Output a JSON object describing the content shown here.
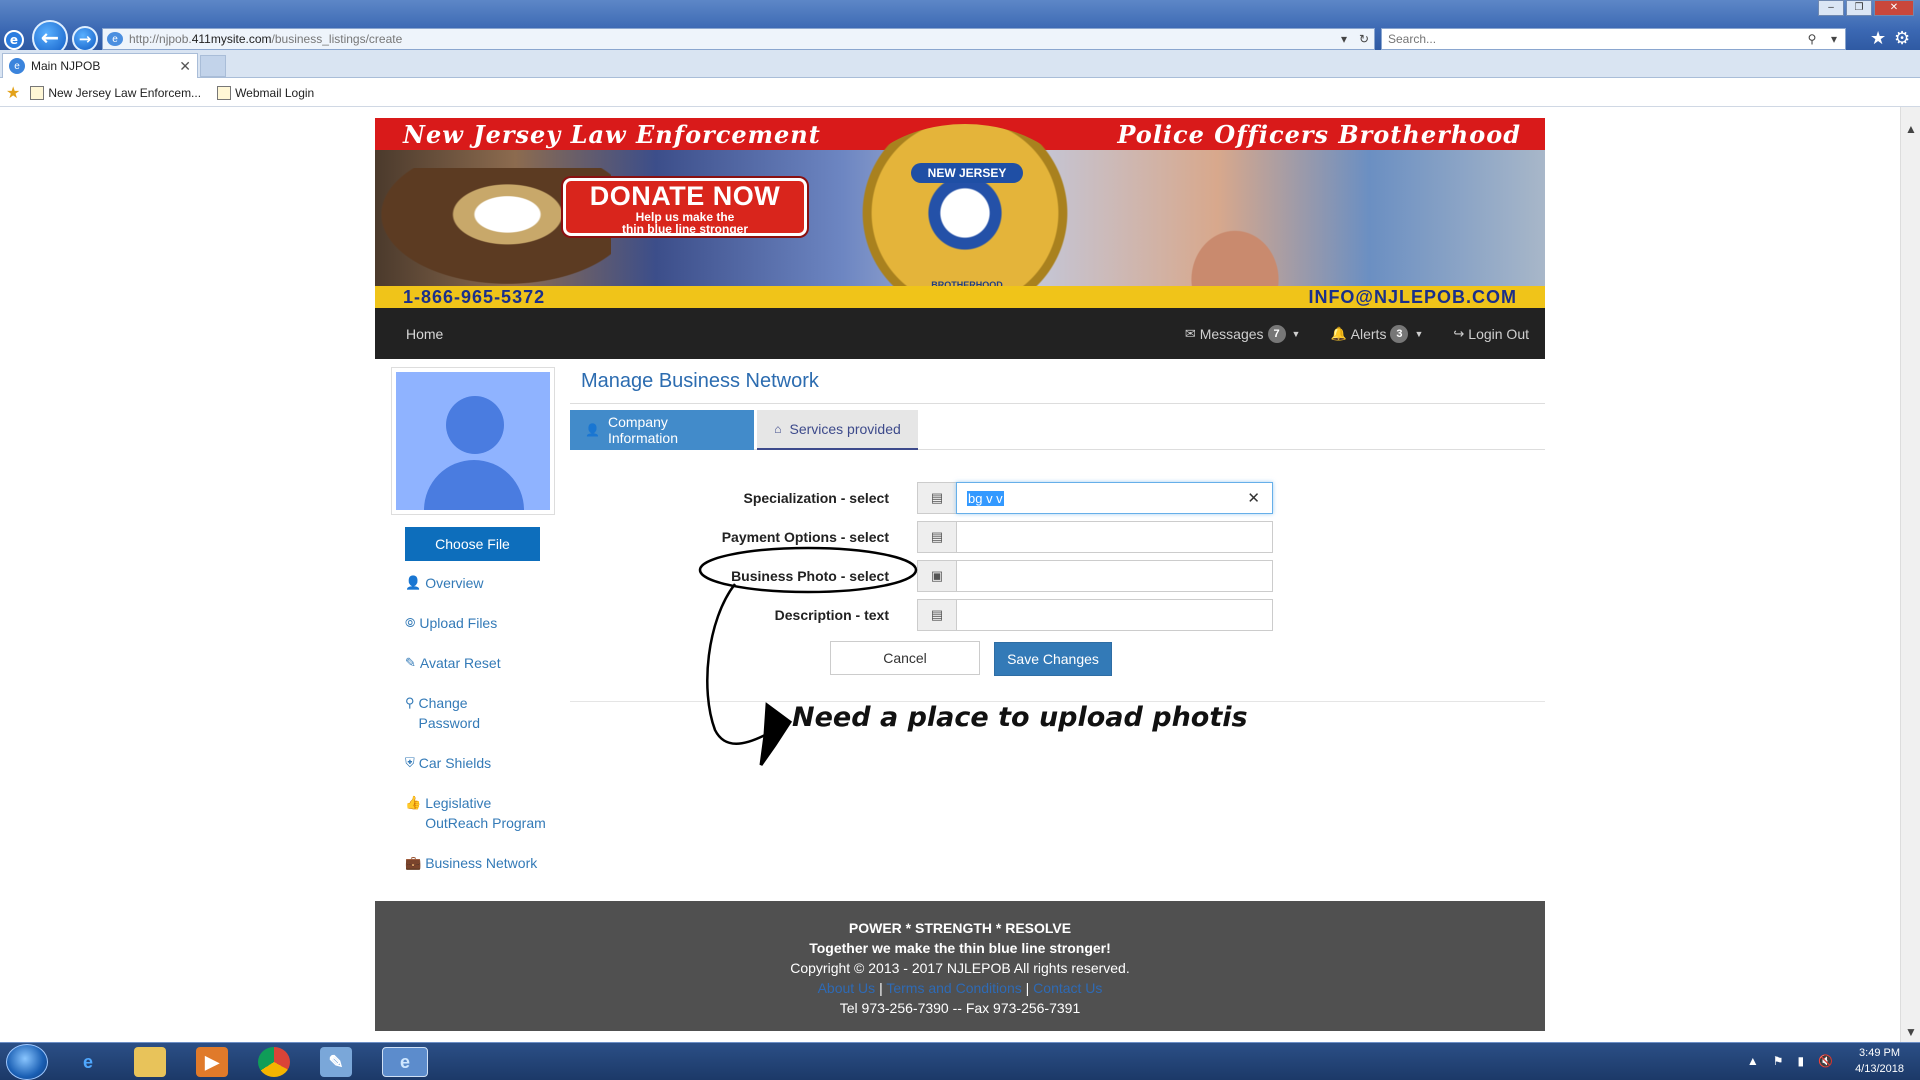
{
  "browser": {
    "url_prefix": "http://njpob.",
    "url_host": "411mysite.com",
    "url_path": "/business_listings/create",
    "search_placeholder": "Search...",
    "tab_title": "Main NJPOB",
    "favorites": [
      {
        "label": "New Jersey Law Enforcem..."
      },
      {
        "label": "Webmail Login"
      }
    ]
  },
  "banner": {
    "left_title": "New Jersey Law Enforcement",
    "right_title": "Police Officers Brotherhood",
    "donate_title": "DONATE NOW",
    "donate_sub1": "Help us make the",
    "donate_sub2": "thin blue line stronger",
    "badge_top": "NEW JERSEY",
    "badge_bottom": "BROTHERHOOD",
    "phone": "1-866-965-5372",
    "email": "INFO@NJLEPOB.COM"
  },
  "navbar": {
    "home": "Home",
    "messages_label": "Messages",
    "messages_count": "7",
    "alerts_label": "Alerts",
    "alerts_count": "3",
    "logout": "Login Out"
  },
  "sidebar": {
    "choose_file": "Choose File",
    "items": [
      {
        "label": "Overview",
        "icon": "user-icon"
      },
      {
        "label": "Upload Files",
        "icon": "upload-icon"
      },
      {
        "label": "Avatar Reset",
        "icon": "eraser-icon"
      },
      {
        "label": "Change Password",
        "icon": "key-icon"
      },
      {
        "label": "Car Shields",
        "icon": "shield-icon"
      },
      {
        "label": "Legislative OutReach Program",
        "icon": "thumbs-up-icon"
      },
      {
        "label": "Business Network",
        "icon": "briefcase-icon"
      }
    ]
  },
  "main": {
    "title": "Manage Business Network",
    "tabs": [
      {
        "label": "Company Information",
        "icon": "user-icon"
      },
      {
        "label": "Services provided",
        "icon": "home-icon"
      }
    ],
    "form": {
      "specialization_label": "Specialization - select",
      "specialization_value": "bg v  v",
      "payment_label": "Payment Options - select",
      "photo_label": "Business Photo - select",
      "description_label": "Description - text",
      "cancel": "Cancel",
      "save": "Save Changes"
    }
  },
  "annotation": {
    "text": "Need a place to upload photis"
  },
  "footer": {
    "line1": "POWER * STRENGTH * RESOLVE",
    "line2": "Together we make the thin blue line stronger!",
    "line3": "Copyright © 2013 - 2017 NJLEPOB   All rights reserved.",
    "link_about": "About Us",
    "link_terms": "Terms and Conditions",
    "link_contact": "Contact Us",
    "line5": "Tel 973-256-7390 -- Fax 973-256-7391"
  },
  "taskbar": {
    "time": "3:49 PM",
    "date": "4/13/2018"
  }
}
